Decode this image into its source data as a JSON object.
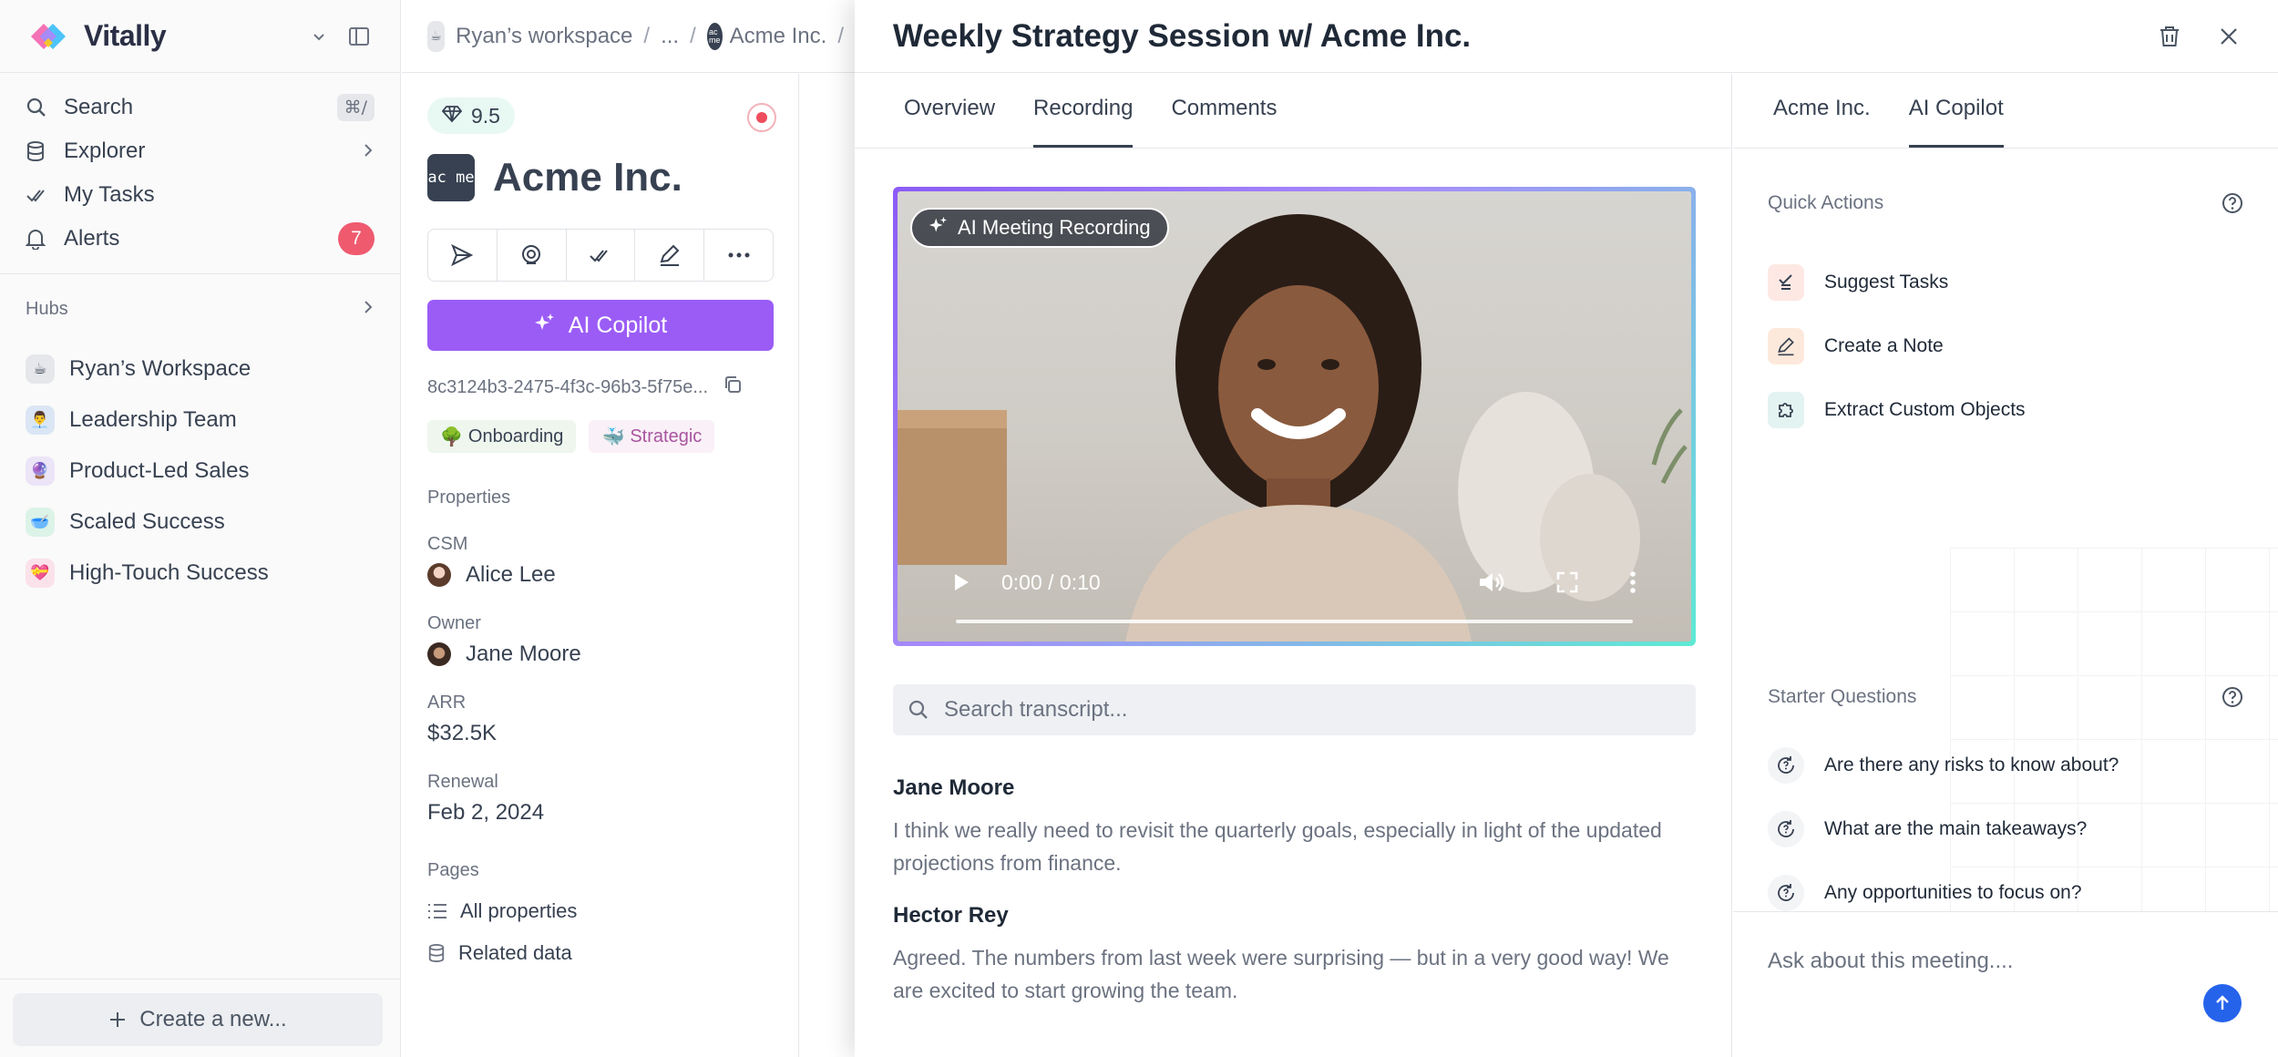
{
  "sidebar": {
    "brand": "Vitally",
    "nav": [
      {
        "label": "Search",
        "shortcut": "⌘/"
      },
      {
        "label": "Explorer"
      },
      {
        "label": "My Tasks"
      },
      {
        "label": "Alerts",
        "count": "7"
      }
    ],
    "hubs_label": "Hubs",
    "hubs": [
      {
        "label": "Ryan’s Workspace"
      },
      {
        "label": "Leadership Team"
      },
      {
        "label": "Product-Led Sales"
      },
      {
        "label": "Scaled Success"
      },
      {
        "label": "High-Touch Success"
      }
    ],
    "create_label": "Create a new..."
  },
  "breadcrumb": {
    "workspace": "Ryan’s workspace",
    "ellipsis": "...",
    "account": "Acme Inc.",
    "separator": "/"
  },
  "account": {
    "health_score": "9.5",
    "logo_text": "ac me",
    "name": "Acme Inc.",
    "copilot_label": "AI Copilot",
    "uuid": "8c3124b3-2475-4f3c-96b3-5f75e...",
    "tags": [
      {
        "label": "Onboarding",
        "emoji": "🌳"
      },
      {
        "label": "Strategic",
        "emoji": "🐳"
      }
    ],
    "properties_label": "Properties",
    "properties": {
      "csm_label": "CSM",
      "csm": "Alice Lee",
      "owner_label": "Owner",
      "owner": "Jane Moore",
      "arr_label": "ARR",
      "arr": "$32.5K",
      "renewal_label": "Renewal",
      "renewal": "Feb 2, 2024"
    },
    "pages_label": "Pages",
    "pages": [
      {
        "label": "All properties"
      },
      {
        "label": "Related data"
      }
    ]
  },
  "drawer": {
    "title": "Weekly Strategy Session w/ Acme Inc.",
    "tabs": [
      {
        "label": "Overview"
      },
      {
        "label": "Recording"
      },
      {
        "label": "Comments"
      }
    ],
    "active_tab": "Recording",
    "video": {
      "badge": "AI Meeting Recording",
      "time": "0:00 / 0:10",
      "progress": 0
    },
    "search_placeholder": "Search transcript...",
    "transcript": [
      {
        "speaker": "Jane Moore",
        "text": "I think we really need to revisit the quarterly goals, especially in light of the updated projections from finance."
      },
      {
        "speaker": "Hector Rey",
        "text": "Agreed. The numbers from last week were surprising — but in a very good way! We are excited to start growing the team."
      }
    ]
  },
  "copilot": {
    "tabs": [
      {
        "label": "Acme Inc."
      },
      {
        "label": "AI Copilot"
      }
    ],
    "active_tab": "AI Copilot",
    "quick_actions_label": "Quick Actions",
    "quick_actions": [
      {
        "label": "Suggest Tasks",
        "icon": "task-check-icon"
      },
      {
        "label": "Create a Note",
        "icon": "pencil-note-icon"
      },
      {
        "label": "Extract Custom Objects",
        "icon": "puzzle-icon"
      }
    ],
    "starter_label": "Starter Questions",
    "starter_questions": [
      {
        "label": "Are there any risks to know about?"
      },
      {
        "label": "What are the main takeaways?"
      },
      {
        "label": "Any opportunities to focus on?"
      }
    ],
    "ask_placeholder": "Ask about this meeting...."
  },
  "colors": {
    "accent_purple": "#9b5cf6",
    "alert_red": "#ef5a6f",
    "send_blue": "#2563eb"
  }
}
